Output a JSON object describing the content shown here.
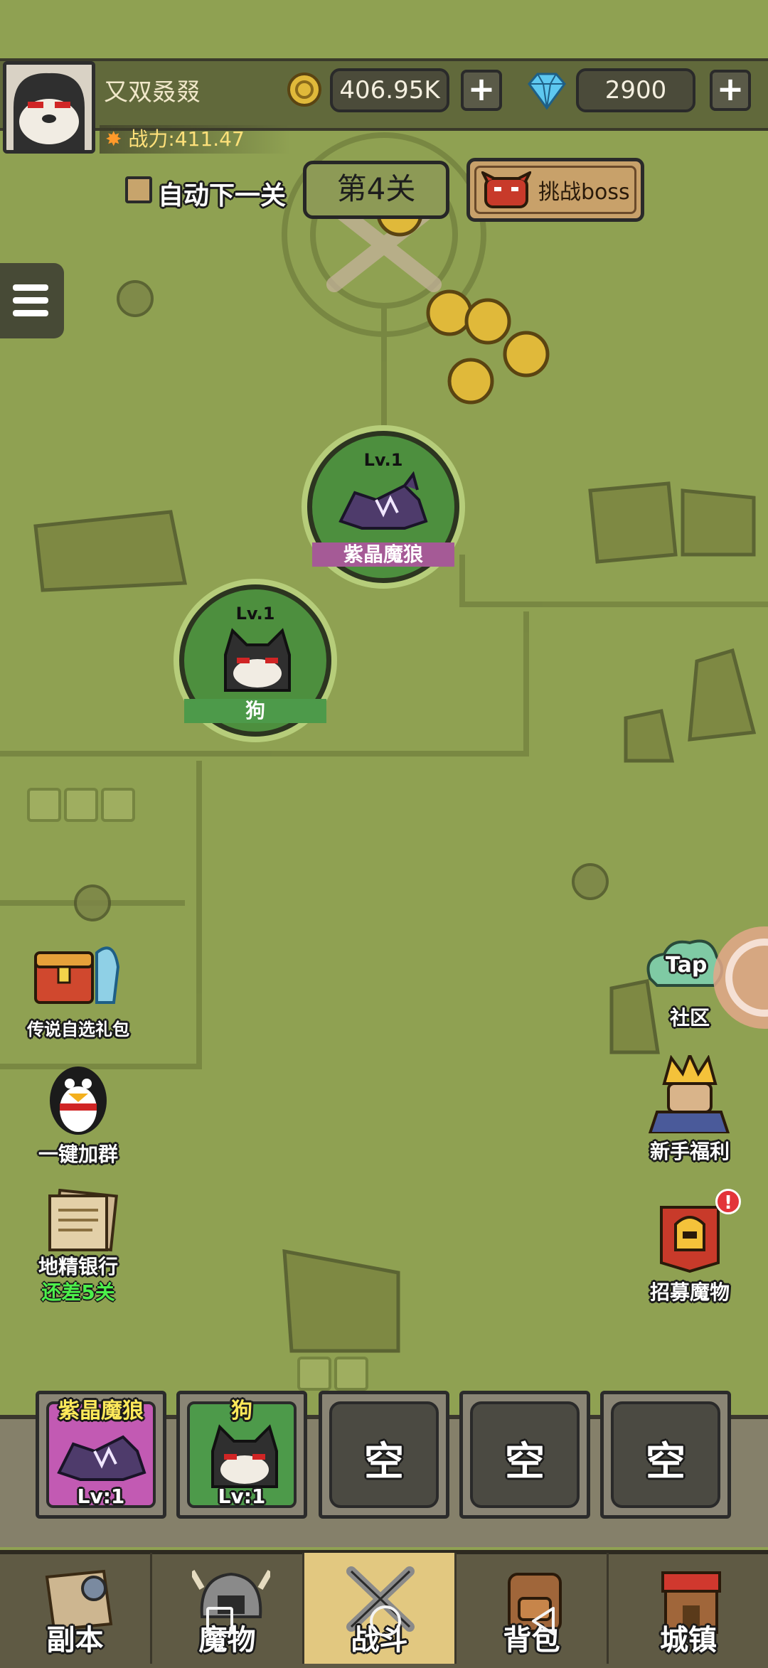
{
  "player": {
    "name": "又双叒叕",
    "power_label": "战力:411.47",
    "gold": "406.95K",
    "gems": "2900",
    "plus": "+"
  },
  "stage": {
    "auto_next": "自动下一关",
    "current": "第4关",
    "boss_button": "挑战boss"
  },
  "map_monsters": [
    {
      "level": "Lv.1",
      "name": "紫晶魔狼"
    },
    {
      "level": "Lv.1",
      "name": "狗"
    }
  ],
  "left_features": [
    {
      "label": "传说自选礼包"
    },
    {
      "label": "一键加群"
    },
    {
      "label": "地精银行",
      "sub": "还差5关"
    }
  ],
  "right_features": [
    {
      "label": "社区",
      "badge": "Tap"
    },
    {
      "label": "新手福利"
    },
    {
      "label": "招募魔物",
      "alert": "!"
    }
  ],
  "slots": [
    {
      "name": "紫晶魔狼",
      "level": "Lv:1"
    },
    {
      "name": "狗",
      "level": "Lv:1"
    },
    {
      "label": "空"
    },
    {
      "label": "空"
    },
    {
      "label": "空"
    }
  ],
  "nav": [
    {
      "label": "副本"
    },
    {
      "label": "魔物"
    },
    {
      "label": "战斗"
    },
    {
      "label": "背包"
    },
    {
      "label": "城镇"
    }
  ],
  "colors": {
    "map": "#8fa152",
    "slot_wolf": "#c25ab3",
    "slot_dog": "#4d9a4a",
    "nav_active": "#e2c880"
  }
}
